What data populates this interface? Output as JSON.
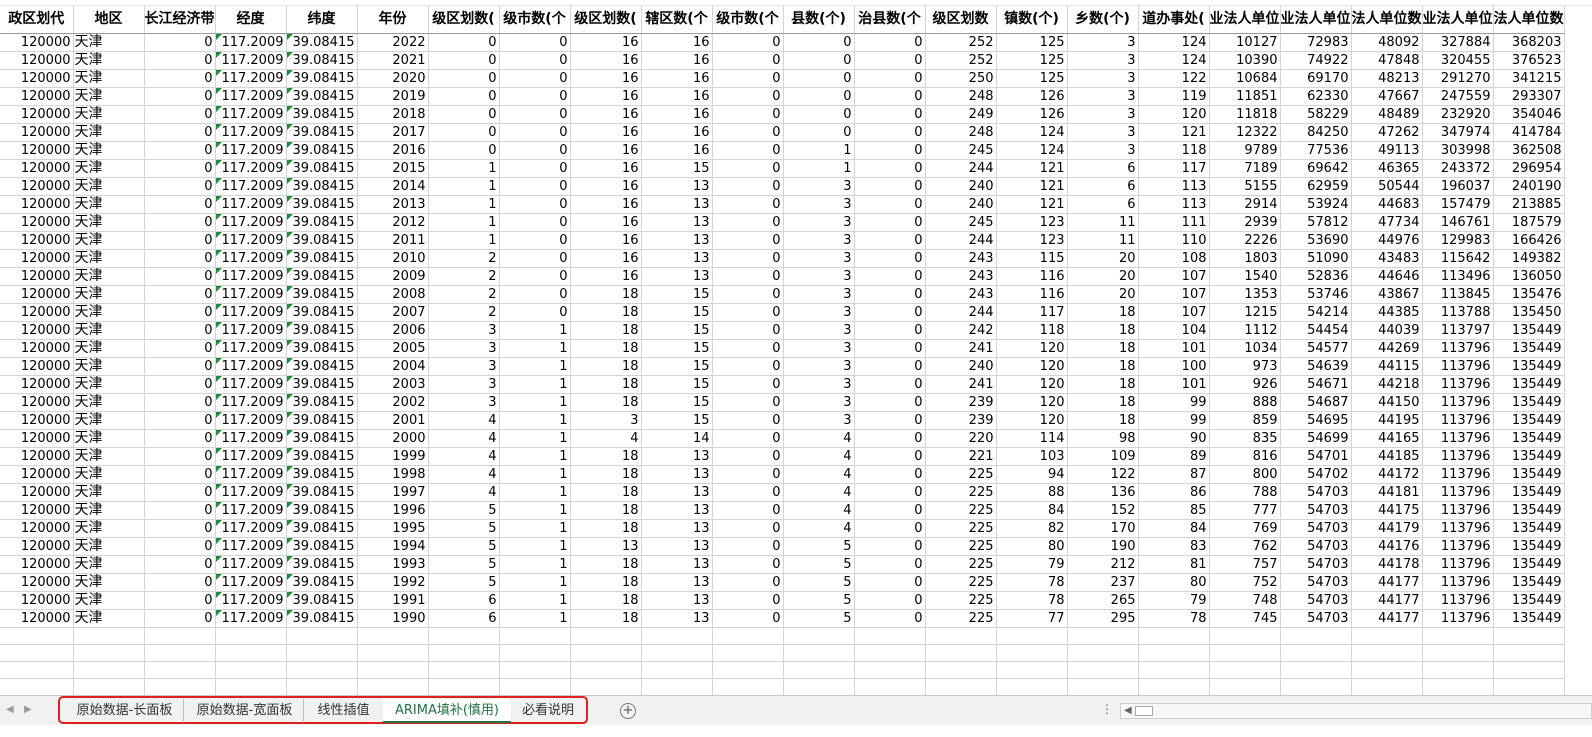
{
  "columns": [
    "行政区划代码",
    "地区",
    "长江经济带",
    "经度",
    "纬度",
    "年份",
    "地级区划数(个)",
    "地级市数(个)",
    "县级区划数(个)",
    "市辖区数(个)",
    "县级市数(个)",
    "县数(个)",
    "自治县数(个)",
    "乡级区划数(个)",
    "镇数(个)",
    "乡数(个)",
    "街道办事处(个)",
    "企业法人单位数",
    "事业法人单位数",
    "机关法人单位数",
    "社团法人单位数",
    "其他法人单位数"
  ],
  "header_display": [
    "政区划代",
    "地区",
    "长江经济带",
    "经度",
    "纬度",
    "年份",
    "级区划数(",
    "级市数(个",
    "级区划数(",
    "辖区数(个",
    "级市数(个",
    "县数(个)",
    "治县数(个",
    "级区划数",
    "镇数(个)",
    "乡数(个)",
    "道办事处(",
    "业法人单位",
    "业法人单位",
    "法人单位数",
    "业法人单位数",
    "法人单位数"
  ],
  "rows": [
    [
      "120000",
      "天津",
      "0",
      "117.2009",
      "39.08415",
      "2022",
      "0",
      "0",
      "16",
      "16",
      "0",
      "0",
      "0",
      "252",
      "125",
      "3",
      "124",
      "10127",
      "72983",
      "48092",
      "327884",
      "368203"
    ],
    [
      "120000",
      "天津",
      "0",
      "117.2009",
      "39.08415",
      "2021",
      "0",
      "0",
      "16",
      "16",
      "0",
      "0",
      "0",
      "252",
      "125",
      "3",
      "124",
      "10390",
      "74922",
      "47848",
      "320455",
      "376523"
    ],
    [
      "120000",
      "天津",
      "0",
      "117.2009",
      "39.08415",
      "2020",
      "0",
      "0",
      "16",
      "16",
      "0",
      "0",
      "0",
      "250",
      "125",
      "3",
      "122",
      "10684",
      "69170",
      "48213",
      "291270",
      "341215"
    ],
    [
      "120000",
      "天津",
      "0",
      "117.2009",
      "39.08415",
      "2019",
      "0",
      "0",
      "16",
      "16",
      "0",
      "0",
      "0",
      "248",
      "126",
      "3",
      "119",
      "11851",
      "62330",
      "47667",
      "247559",
      "293307"
    ],
    [
      "120000",
      "天津",
      "0",
      "117.2009",
      "39.08415",
      "2018",
      "0",
      "0",
      "16",
      "16",
      "0",
      "0",
      "0",
      "249",
      "126",
      "3",
      "120",
      "11818",
      "58229",
      "48489",
      "232920",
      "354046"
    ],
    [
      "120000",
      "天津",
      "0",
      "117.2009",
      "39.08415",
      "2017",
      "0",
      "0",
      "16",
      "16",
      "0",
      "0",
      "0",
      "248",
      "124",
      "3",
      "121",
      "12322",
      "84250",
      "47262",
      "347974",
      "414784"
    ],
    [
      "120000",
      "天津",
      "0",
      "117.2009",
      "39.08415",
      "2016",
      "0",
      "0",
      "16",
      "16",
      "0",
      "1",
      "0",
      "245",
      "124",
      "3",
      "118",
      "9789",
      "77536",
      "49113",
      "303998",
      "362508"
    ],
    [
      "120000",
      "天津",
      "0",
      "117.2009",
      "39.08415",
      "2015",
      "1",
      "0",
      "16",
      "15",
      "0",
      "1",
      "0",
      "244",
      "121",
      "6",
      "117",
      "7189",
      "69642",
      "46365",
      "243372",
      "296954"
    ],
    [
      "120000",
      "天津",
      "0",
      "117.2009",
      "39.08415",
      "2014",
      "1",
      "0",
      "16",
      "13",
      "0",
      "3",
      "0",
      "240",
      "121",
      "6",
      "113",
      "5155",
      "62959",
      "50544",
      "196037",
      "240190"
    ],
    [
      "120000",
      "天津",
      "0",
      "117.2009",
      "39.08415",
      "2013",
      "1",
      "0",
      "16",
      "13",
      "0",
      "3",
      "0",
      "240",
      "121",
      "6",
      "113",
      "2914",
      "53924",
      "44683",
      "157479",
      "213885"
    ],
    [
      "120000",
      "天津",
      "0",
      "117.2009",
      "39.08415",
      "2012",
      "1",
      "0",
      "16",
      "13",
      "0",
      "3",
      "0",
      "245",
      "123",
      "11",
      "111",
      "2939",
      "57812",
      "47734",
      "146761",
      "187579"
    ],
    [
      "120000",
      "天津",
      "0",
      "117.2009",
      "39.08415",
      "2011",
      "1",
      "0",
      "16",
      "13",
      "0",
      "3",
      "0",
      "244",
      "123",
      "11",
      "110",
      "2226",
      "53690",
      "44976",
      "129983",
      "166426"
    ],
    [
      "120000",
      "天津",
      "0",
      "117.2009",
      "39.08415",
      "2010",
      "2",
      "0",
      "16",
      "13",
      "0",
      "3",
      "0",
      "243",
      "115",
      "20",
      "108",
      "1803",
      "51090",
      "43483",
      "115642",
      "149382"
    ],
    [
      "120000",
      "天津",
      "0",
      "117.2009",
      "39.08415",
      "2009",
      "2",
      "0",
      "16",
      "13",
      "0",
      "3",
      "0",
      "243",
      "116",
      "20",
      "107",
      "1540",
      "52836",
      "44646",
      "113496",
      "136050"
    ],
    [
      "120000",
      "天津",
      "0",
      "117.2009",
      "39.08415",
      "2008",
      "2",
      "0",
      "18",
      "15",
      "0",
      "3",
      "0",
      "243",
      "116",
      "20",
      "107",
      "1353",
      "53746",
      "43867",
      "113845",
      "135476"
    ],
    [
      "120000",
      "天津",
      "0",
      "117.2009",
      "39.08415",
      "2007",
      "2",
      "0",
      "18",
      "15",
      "0",
      "3",
      "0",
      "244",
      "117",
      "18",
      "107",
      "1215",
      "54214",
      "44385",
      "113788",
      "135450"
    ],
    [
      "120000",
      "天津",
      "0",
      "117.2009",
      "39.08415",
      "2006",
      "3",
      "1",
      "18",
      "15",
      "0",
      "3",
      "0",
      "242",
      "118",
      "18",
      "104",
      "1112",
      "54454",
      "44039",
      "113797",
      "135449"
    ],
    [
      "120000",
      "天津",
      "0",
      "117.2009",
      "39.08415",
      "2005",
      "3",
      "1",
      "18",
      "15",
      "0",
      "3",
      "0",
      "241",
      "120",
      "18",
      "101",
      "1034",
      "54577",
      "44269",
      "113796",
      "135449"
    ],
    [
      "120000",
      "天津",
      "0",
      "117.2009",
      "39.08415",
      "2004",
      "3",
      "1",
      "18",
      "15",
      "0",
      "3",
      "0",
      "240",
      "120",
      "18",
      "100",
      "973",
      "54639",
      "44115",
      "113796",
      "135449"
    ],
    [
      "120000",
      "天津",
      "0",
      "117.2009",
      "39.08415",
      "2003",
      "3",
      "1",
      "18",
      "15",
      "0",
      "3",
      "0",
      "241",
      "120",
      "18",
      "101",
      "926",
      "54671",
      "44218",
      "113796",
      "135449"
    ],
    [
      "120000",
      "天津",
      "0",
      "117.2009",
      "39.08415",
      "2002",
      "3",
      "1",
      "18",
      "15",
      "0",
      "3",
      "0",
      "239",
      "120",
      "18",
      "99",
      "888",
      "54687",
      "44150",
      "113796",
      "135449"
    ],
    [
      "120000",
      "天津",
      "0",
      "117.2009",
      "39.08415",
      "2001",
      "4",
      "1",
      "3",
      "15",
      "0",
      "3",
      "0",
      "239",
      "120",
      "18",
      "99",
      "859",
      "54695",
      "44195",
      "113796",
      "135449"
    ],
    [
      "120000",
      "天津",
      "0",
      "117.2009",
      "39.08415",
      "2000",
      "4",
      "1",
      "4",
      "14",
      "0",
      "4",
      "0",
      "220",
      "114",
      "98",
      "90",
      "835",
      "54699",
      "44165",
      "113796",
      "135449"
    ],
    [
      "120000",
      "天津",
      "0",
      "117.2009",
      "39.08415",
      "1999",
      "4",
      "1",
      "18",
      "13",
      "0",
      "4",
      "0",
      "221",
      "103",
      "109",
      "89",
      "816",
      "54701",
      "44185",
      "113796",
      "135449"
    ],
    [
      "120000",
      "天津",
      "0",
      "117.2009",
      "39.08415",
      "1998",
      "4",
      "1",
      "18",
      "13",
      "0",
      "4",
      "0",
      "225",
      "94",
      "122",
      "87",
      "800",
      "54702",
      "44172",
      "113796",
      "135449"
    ],
    [
      "120000",
      "天津",
      "0",
      "117.2009",
      "39.08415",
      "1997",
      "4",
      "1",
      "18",
      "13",
      "0",
      "4",
      "0",
      "225",
      "88",
      "136",
      "86",
      "788",
      "54703",
      "44181",
      "113796",
      "135449"
    ],
    [
      "120000",
      "天津",
      "0",
      "117.2009",
      "39.08415",
      "1996",
      "5",
      "1",
      "18",
      "13",
      "0",
      "4",
      "0",
      "225",
      "84",
      "152",
      "85",
      "777",
      "54703",
      "44175",
      "113796",
      "135449"
    ],
    [
      "120000",
      "天津",
      "0",
      "117.2009",
      "39.08415",
      "1995",
      "5",
      "1",
      "18",
      "13",
      "0",
      "4",
      "0",
      "225",
      "82",
      "170",
      "84",
      "769",
      "54703",
      "44179",
      "113796",
      "135449"
    ],
    [
      "120000",
      "天津",
      "0",
      "117.2009",
      "39.08415",
      "1994",
      "5",
      "1",
      "13",
      "13",
      "0",
      "5",
      "0",
      "225",
      "80",
      "190",
      "83",
      "762",
      "54703",
      "44176",
      "113796",
      "135449"
    ],
    [
      "120000",
      "天津",
      "0",
      "117.2009",
      "39.08415",
      "1993",
      "5",
      "1",
      "18",
      "13",
      "0",
      "5",
      "0",
      "225",
      "79",
      "212",
      "81",
      "757",
      "54703",
      "44178",
      "113796",
      "135449"
    ],
    [
      "120000",
      "天津",
      "0",
      "117.2009",
      "39.08415",
      "1992",
      "5",
      "1",
      "18",
      "13",
      "0",
      "5",
      "0",
      "225",
      "78",
      "237",
      "80",
      "752",
      "54703",
      "44177",
      "113796",
      "135449"
    ],
    [
      "120000",
      "天津",
      "0",
      "117.2009",
      "39.08415",
      "1991",
      "6",
      "1",
      "18",
      "13",
      "0",
      "5",
      "0",
      "225",
      "78",
      "265",
      "79",
      "748",
      "54703",
      "44177",
      "113796",
      "135449"
    ],
    [
      "120000",
      "天津",
      "0",
      "117.2009",
      "39.08415",
      "1990",
      "6",
      "1",
      "18",
      "13",
      "0",
      "5",
      "0",
      "225",
      "77",
      "295",
      "78",
      "745",
      "54703",
      "44177",
      "113796",
      "135449"
    ]
  ],
  "sheet_tabs": [
    {
      "label": "原始数据-长面板",
      "active": false
    },
    {
      "label": "原始数据-宽面板",
      "active": false
    },
    {
      "label": "线性插值",
      "active": false
    },
    {
      "label": "ARIMA填补(慎用)",
      "active": true
    },
    {
      "label": "必看说明",
      "active": false
    }
  ],
  "tabbar": {
    "add_label": "+",
    "more_label": "⋮",
    "scroll_left": "◀",
    "nav_prev": "◀",
    "nav_next": "▶"
  },
  "colors": {
    "active_tab": "#217346",
    "highlight_outline": "#e02020",
    "error_marker": "#1e8a3c",
    "grid_line": "#d4d4d4"
  }
}
